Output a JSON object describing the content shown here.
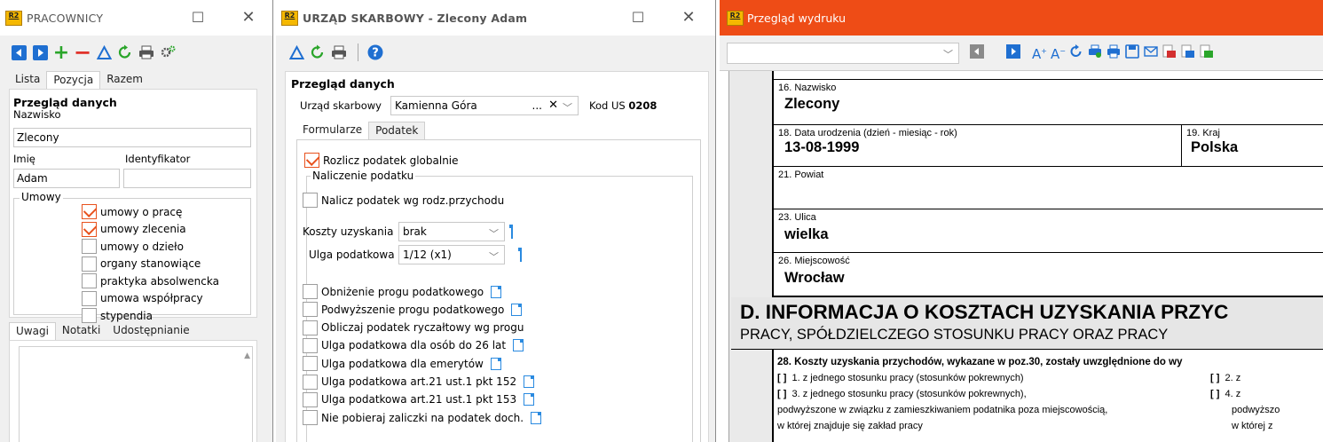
{
  "w1": {
    "logo": "R2",
    "title": "PRACOWNICY",
    "tabs": [
      "Lista",
      "Pozycja",
      "Razem"
    ],
    "section": "Przegląd danych",
    "nazwisko_label": "Nazwisko",
    "nazwisko": "Zlecony",
    "imie_label": "Imię",
    "ident_label": "Identyfikator",
    "imie": "Adam",
    "ident": "",
    "umowy_label": "Umowy",
    "umowy": [
      {
        "label": "umowy o pracę",
        "checked": true
      },
      {
        "label": "umowy zlecenia",
        "checked": true
      },
      {
        "label": "umowy o dzieło",
        "checked": false
      },
      {
        "label": "organy stanowiące",
        "checked": false
      },
      {
        "label": "praktyka absolwencka",
        "checked": false
      },
      {
        "label": "umowa współpracy",
        "checked": false
      },
      {
        "label": "stypendia",
        "checked": false
      }
    ],
    "bottom_tabs": [
      "Uwagi",
      "Notatki",
      "Udostępnianie"
    ]
  },
  "w2": {
    "logo": "R2",
    "title": "URZĄD SKARBOWY - Zlecony Adam",
    "section": "Przegląd danych",
    "us_label": "Urząd skarbowy",
    "us_value": "Kamienna Góra",
    "us_dots": "...",
    "kod_label": "Kod US",
    "kod_value": "0208",
    "tabs": [
      "Formularze",
      "Podatek"
    ],
    "rozlicz": "Rozlicz podatek globalnie",
    "naliczenie_label": "Naliczenie podatku",
    "nalicz_wg": "Nalicz podatek wg rodz.przychodu",
    "koszty_label": "Koszty uzyskania",
    "koszty_value": "brak",
    "ulga_label": "Ulga podatkowa",
    "ulga_value": "1/12 (x1)",
    "options": [
      {
        "label": "Obniżenie progu podatkowego",
        "doc": true
      },
      {
        "label": "Podwyższenie progu podatkowego",
        "doc": true
      },
      {
        "label": "Obliczaj podatek ryczałtowy wg progu",
        "doc": false
      },
      {
        "label": "Ulga podatkowa dla osób do 26 lat",
        "doc": true
      },
      {
        "label": "Ulga podatkowa dla emerytów",
        "doc": true
      },
      {
        "label": "Ulga podatkowa art.21 ust.1 pkt 152",
        "doc": true
      },
      {
        "label": "Ulga podatkowa art.21 ust.1 pkt 153",
        "doc": true
      },
      {
        "label": "Nie pobieraj zaliczki na podatek doch.",
        "doc": true
      }
    ]
  },
  "w3": {
    "logo": "R2",
    "title": "Przegląd wydruku",
    "f16_label": "16. Nazwisko",
    "f16_value": "Zlecony",
    "f18_label": "18. Data urodzenia (dzień - miesiąc - rok)",
    "f18_value": "13-08-1999",
    "f19_label": "19. Kraj",
    "f19_value": "Polska",
    "f21_label": "21. Powiat",
    "f23_label": "23. Ulica",
    "f23_value": "wielka",
    "f26_label": "26. Miejscowość",
    "f26_value": "Wrocław",
    "heading_d": "D. INFORMACJA O KOSZTACH UZYSKANIA PRZYC",
    "heading_d2": "PRACY, SPÓŁDZIELCZEGO STOSUNKU PRACY ORAZ PRACY",
    "f28": "28. Koszty uzyskania przychodów, wykazane w poz.30, zostały uwzględnione do wy",
    "opt1": "1. z jednego stosunku pracy (stosunków pokrewnych)",
    "opt2": "2. z",
    "opt3": "3. z jednego stosunku pracy (stosunków pokrewnych),",
    "opt4": "4. z",
    "line3": "podwyższone w związku z zamieszkiwaniem podatnika poza miejscowością,",
    "line3r": "podwyższo",
    "line4": "w której znajduje się zakład pracy",
    "line4r": "w której z",
    "br": "[ ]"
  },
  "colors": {
    "accent": "#ee4c16",
    "check": "#e8521e",
    "tool_blue": "#1f6fd1",
    "tool_green": "#2aa52a",
    "tool_red": "#e0322a"
  }
}
